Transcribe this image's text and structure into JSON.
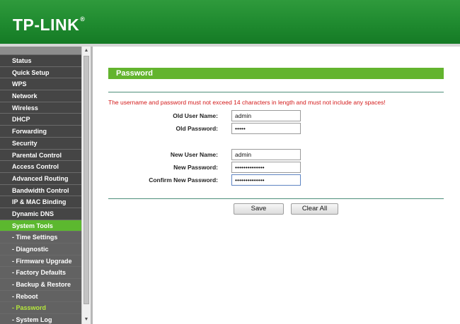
{
  "header": {
    "logo": "TP-LINK",
    "logo_mark": "®"
  },
  "sidebar": {
    "items": [
      {
        "label": "Status",
        "type": "main"
      },
      {
        "label": "Quick Setup",
        "type": "main"
      },
      {
        "label": "WPS",
        "type": "main"
      },
      {
        "label": "Network",
        "type": "main"
      },
      {
        "label": "Wireless",
        "type": "main"
      },
      {
        "label": "DHCP",
        "type": "main"
      },
      {
        "label": "Forwarding",
        "type": "main"
      },
      {
        "label": "Security",
        "type": "main"
      },
      {
        "label": "Parental Control",
        "type": "main"
      },
      {
        "label": "Access Control",
        "type": "main"
      },
      {
        "label": "Advanced Routing",
        "type": "main"
      },
      {
        "label": "Bandwidth Control",
        "type": "main"
      },
      {
        "label": "IP & MAC Binding",
        "type": "main"
      },
      {
        "label": "Dynamic DNS",
        "type": "main"
      },
      {
        "label": "System Tools",
        "type": "active"
      },
      {
        "label": "- Time Settings",
        "type": "sub"
      },
      {
        "label": "- Diagnostic",
        "type": "sub"
      },
      {
        "label": "- Firmware Upgrade",
        "type": "sub"
      },
      {
        "label": "- Factory Defaults",
        "type": "sub"
      },
      {
        "label": "- Backup & Restore",
        "type": "sub"
      },
      {
        "label": "- Reboot",
        "type": "sub"
      },
      {
        "label": "- Password",
        "type": "current"
      },
      {
        "label": "- System Log",
        "type": "sub"
      }
    ]
  },
  "main": {
    "title": "Password",
    "warning": "The username and password must not exceed 14 characters in length and must not include any spaces!",
    "fields": {
      "old_user_name": {
        "label": "Old User Name:",
        "value": "admin"
      },
      "old_password": {
        "label": "Old Password:",
        "value": "•••••"
      },
      "new_user_name": {
        "label": "New User Name:",
        "value": "admin"
      },
      "new_password": {
        "label": "New Password:",
        "value": "••••••••••••••"
      },
      "confirm_new_password": {
        "label": "Confirm New Password:",
        "value": "••••••••••••••"
      }
    },
    "buttons": {
      "save": "Save",
      "clear_all": "Clear All"
    }
  },
  "colors": {
    "header_green": "#1f8a2f",
    "title_bar_green": "#63b42e",
    "active_menu_green": "#5cb82f",
    "menu_dark": "#454545",
    "warning_red": "#d31a1a",
    "current_sub_text": "#b6e93b"
  }
}
